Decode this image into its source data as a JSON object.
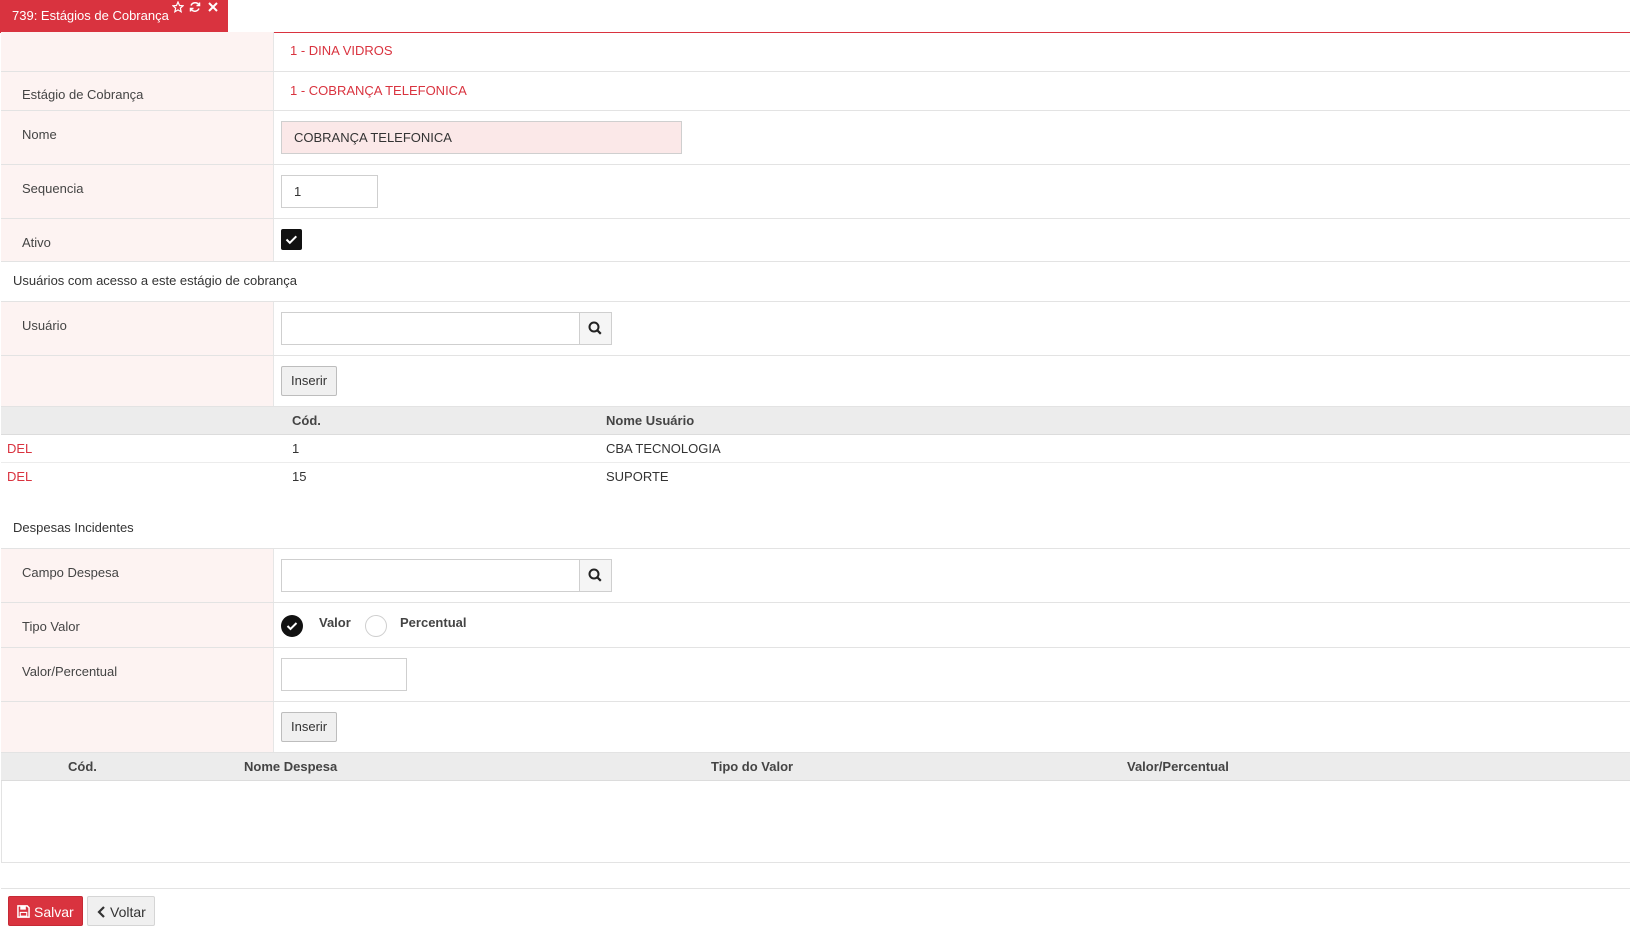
{
  "tab": {
    "title": "739: Estágios de Cobrança",
    "icons": [
      "star-icon",
      "refresh-icon",
      "close-icon"
    ]
  },
  "form": {
    "empresa": "1 - DINA VIDROS",
    "estagio_label": "Estágio de Cobrança",
    "estagio_value": "1 - COBRANÇA TELEFONICA",
    "nome_label": "Nome",
    "nome_value": "COBRANÇA TELEFONICA",
    "sequencia_label": "Sequencia",
    "sequencia_value": "1",
    "ativo_label": "Ativo",
    "ativo_checked": true
  },
  "usuarios": {
    "section_title": "Usuários com acesso a este estágio de cobrança",
    "usuario_label": "Usuário",
    "usuario_value": "",
    "inserir_label": "Inserir",
    "columns": [
      "Cód.",
      "Nome Usuário"
    ],
    "rows": [
      {
        "action": "DEL",
        "cod": "1",
        "nome": "CBA TECNOLOGIA"
      },
      {
        "action": "DEL",
        "cod": "15",
        "nome": "SUPORTE"
      }
    ]
  },
  "despesas": {
    "section_title": "Despesas Incidentes",
    "campo_label": "Campo Despesa",
    "campo_value": "",
    "tipo_label": "Tipo Valor",
    "tipo_options": [
      "Valor",
      "Percentual"
    ],
    "tipo_selected": "Valor",
    "valor_label": "Valor/Percentual",
    "valor_value": "",
    "inserir_label": "Inserir",
    "columns": [
      "Cód.",
      "Nome Despesa",
      "Tipo do Valor",
      "Valor/Percentual"
    ]
  },
  "footer": {
    "save_label": "Salvar",
    "back_label": "Voltar"
  },
  "colors": {
    "accent": "#d9333f",
    "label_bg": "#fdf3f2"
  }
}
